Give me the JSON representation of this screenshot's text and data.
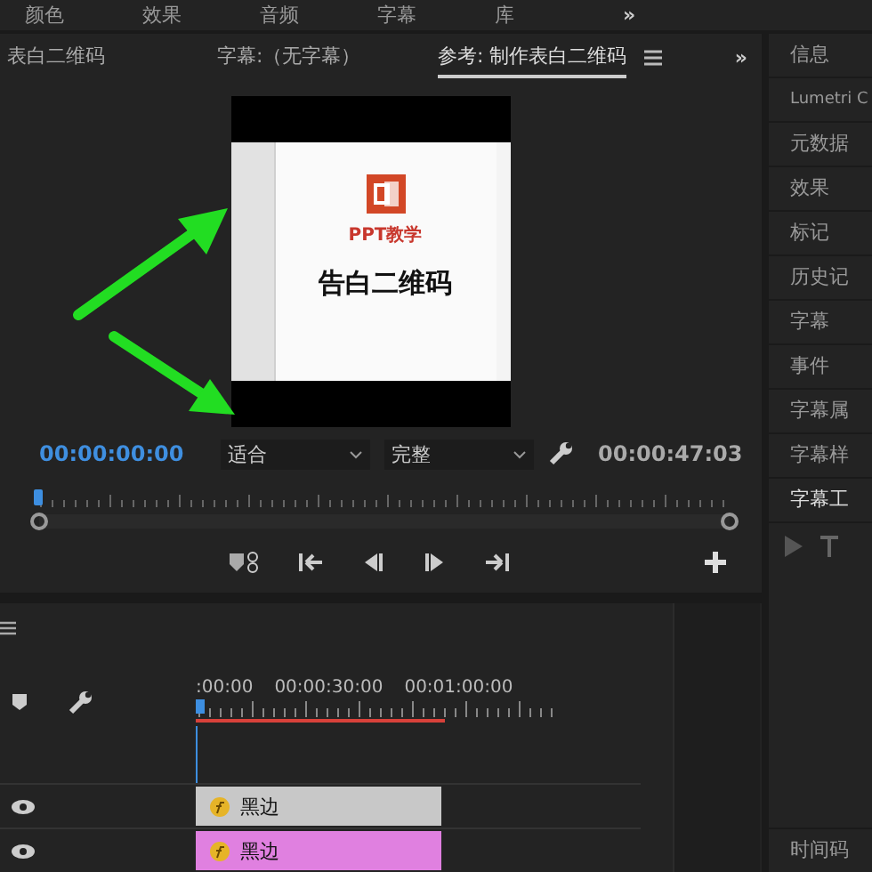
{
  "top_tabs": [
    {
      "label": "颜色"
    },
    {
      "label": "效果"
    },
    {
      "label": "音频"
    },
    {
      "label": "字幕"
    },
    {
      "label": "库"
    }
  ],
  "top_more": "»",
  "monitor": {
    "tabs": [
      {
        "label": "表白二维码",
        "selected": false
      },
      {
        "label": "字幕:（无字幕）",
        "selected": false
      },
      {
        "label": "参考: 制作表白二维码",
        "selected": true
      }
    ],
    "more": "»",
    "slide": {
      "subtitle": "PPT教学",
      "title": "告白二维码"
    },
    "timecode_current": "00:00:00:00",
    "zoom": "适合",
    "quality": "完整",
    "timecode_total": "00:00:47:03"
  },
  "timeline": {
    "ruler": [
      ":00:00",
      "00:00:30:00",
      "00:01:00:00"
    ],
    "clips": [
      {
        "label": "黑边",
        "color": "#c8c8c8"
      },
      {
        "label": "黑边",
        "color": "#e080e0"
      }
    ]
  },
  "side_panels": [
    {
      "label": "信息",
      "selected": false
    },
    {
      "label": "Lumetri C",
      "selected": false
    },
    {
      "label": "元数据",
      "selected": false
    },
    {
      "label": "效果",
      "selected": false
    },
    {
      "label": "标记",
      "selected": false
    },
    {
      "label": "历史记",
      "selected": false
    },
    {
      "label": "字幕",
      "selected": false
    },
    {
      "label": "事件",
      "selected": false
    },
    {
      "label": "字幕属",
      "selected": false
    },
    {
      "label": "字幕样",
      "selected": false
    },
    {
      "label": "字幕工",
      "selected": true
    }
  ],
  "side_bottom": "时间码"
}
